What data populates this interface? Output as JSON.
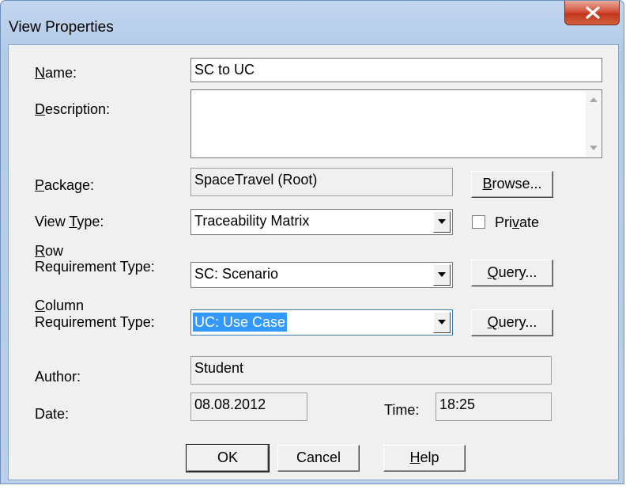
{
  "window": {
    "title": "View Properties",
    "close_glyph": "X"
  },
  "name": {
    "label_u": "N",
    "label_rest": "ame:",
    "value": "SC to UC"
  },
  "description": {
    "label_u": "D",
    "label_rest": "escription:",
    "value": ""
  },
  "package": {
    "label_u": "P",
    "label_rest": "ackage:",
    "value": "SpaceTravel (Root)",
    "browse_u": "B",
    "browse_rest": "rowse..."
  },
  "view_type": {
    "label_pre": "View ",
    "label_u": "T",
    "label_rest": "ype:",
    "value": "Traceability Matrix",
    "private_pre": "Pri",
    "private_u": "v",
    "private_rest": "ate",
    "private_checked": false
  },
  "row_req": {
    "label_u": "R",
    "label_line1_rest": "ow",
    "label_line2": "Requirement Type:",
    "value": "SC: Scenario",
    "query_u": "Q",
    "query_rest": "uery..."
  },
  "col_req": {
    "label_u": "C",
    "label_line1_rest": "olumn",
    "label_line2": "Requirement Type:",
    "value": "UC: Use Case",
    "query_u": "Q",
    "query_rest": "uery..."
  },
  "author": {
    "label": "Author:",
    "value": "Student"
  },
  "date": {
    "label": "Date:",
    "value": "08.08.2012"
  },
  "time": {
    "label": "Time:",
    "value": "18:25"
  },
  "buttons": {
    "ok": "OK",
    "cancel": "Cancel",
    "help_u": "H",
    "help_rest": "elp"
  }
}
